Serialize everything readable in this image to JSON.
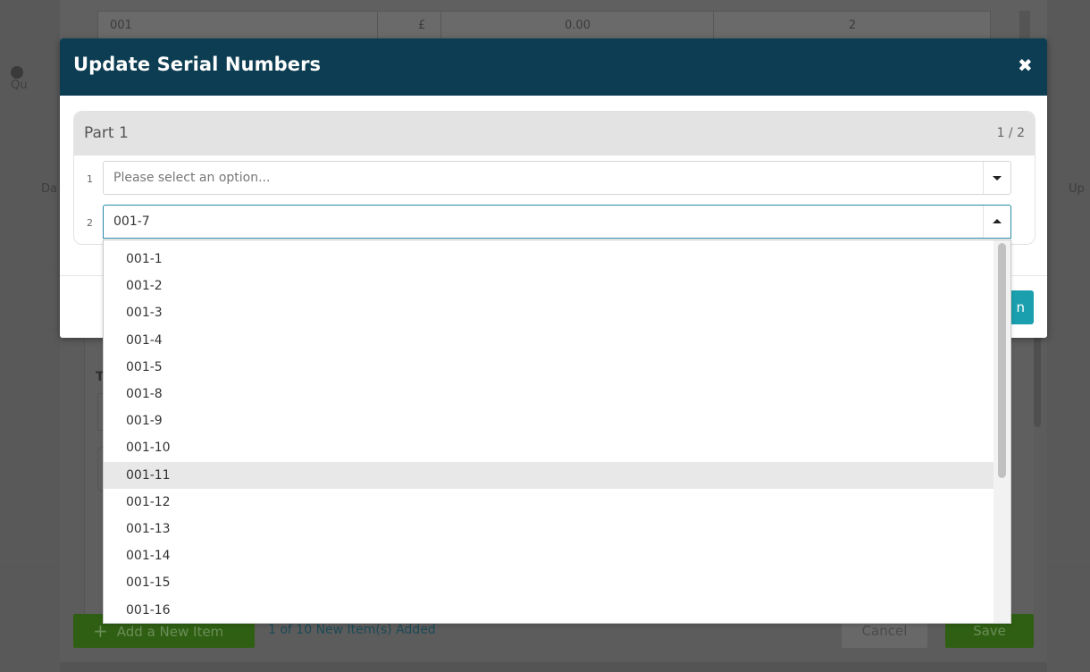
{
  "background": {
    "table_row": {
      "code": "001",
      "currency": "£",
      "price": "0.00",
      "qty": "2"
    },
    "left_label": "Qu",
    "left_label_2": "Da",
    "right_label": "Up",
    "section_letter": "T",
    "add_button": "Add a New Item",
    "items_added": "1 of 10 New Item(s) Added",
    "cancel": "Cancel",
    "save": "Save"
  },
  "modal": {
    "title": "Update Serial Numbers",
    "close_glyph": "✖",
    "part": {
      "title": "Part 1",
      "count": "1 / 2",
      "rows": [
        {
          "num": "1",
          "value": "Please select an option..."
        },
        {
          "num": "2",
          "value": "001-7"
        }
      ]
    },
    "confirm_partial": "n"
  },
  "dropdown": {
    "options": [
      "001-1",
      "001-2",
      "001-3",
      "001-4",
      "001-5",
      "001-8",
      "001-9",
      "001-10",
      "001-11",
      "001-12",
      "001-13",
      "001-14",
      "001-15",
      "001-16"
    ],
    "highlighted": "001-11"
  },
  "colors": {
    "header": "#0d3d52",
    "accent": "#1a9fae",
    "save_green": "#2f5f12"
  }
}
